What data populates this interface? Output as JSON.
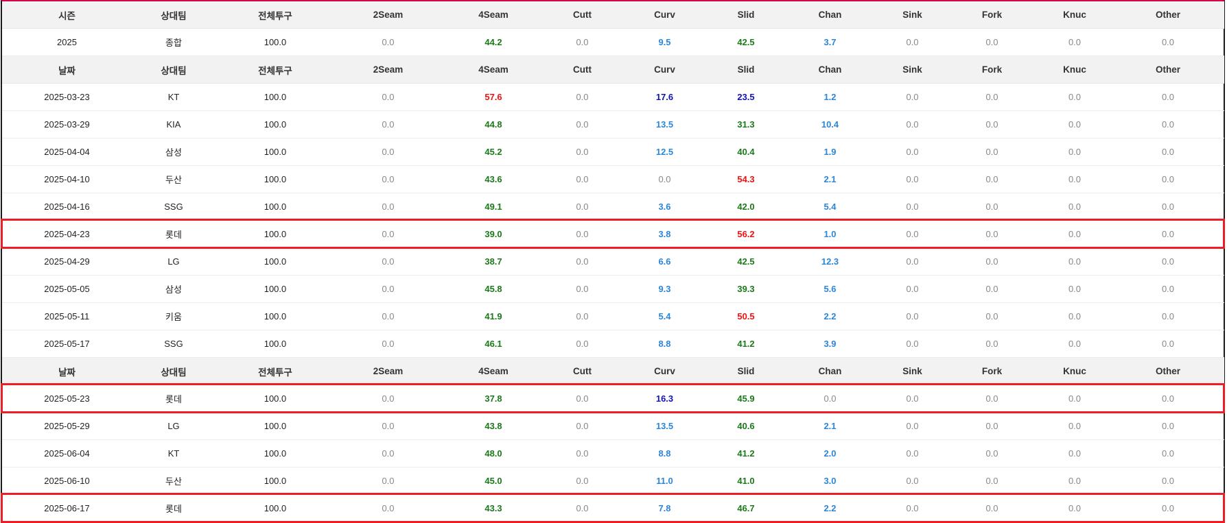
{
  "headers": {
    "season": [
      "시즌",
      "상대팀",
      "전체투구",
      "2Seam",
      "4Seam",
      "Cutt",
      "Curv",
      "Slid",
      "Chan",
      "Sink",
      "Fork",
      "Knuc",
      "Other"
    ],
    "daily": [
      "날짜",
      "상대팀",
      "전체투구",
      "2Seam",
      "4Seam",
      "Cutt",
      "Curv",
      "Slid",
      "Chan",
      "Sink",
      "Fork",
      "Knuc",
      "Other"
    ]
  },
  "colors": {
    "green": "#1a7a1a",
    "red": "#ee1111",
    "blue": "#2b86d9",
    "navy": "#0f13b5",
    "highlight_box": "#ee1c24"
  },
  "rows": [
    {
      "type": "header",
      "header": "season"
    },
    {
      "type": "data",
      "cells": [
        [
          "2025",
          "txt"
        ],
        [
          "종합",
          "txt"
        ],
        [
          "100.0",
          "txt"
        ],
        [
          "0.0",
          ""
        ],
        [
          "44.2",
          "green"
        ],
        [
          "0.0",
          ""
        ],
        [
          "9.5",
          "blue"
        ],
        [
          "42.5",
          "green"
        ],
        [
          "3.7",
          "blue"
        ],
        [
          "0.0",
          ""
        ],
        [
          "0.0",
          ""
        ],
        [
          "0.0",
          ""
        ],
        [
          "0.0",
          ""
        ]
      ]
    },
    {
      "type": "header",
      "header": "daily"
    },
    {
      "type": "data",
      "cells": [
        [
          "2025-03-23",
          "txt"
        ],
        [
          "KT",
          "txt"
        ],
        [
          "100.0",
          "txt"
        ],
        [
          "0.0",
          ""
        ],
        [
          "57.6",
          "red"
        ],
        [
          "0.0",
          ""
        ],
        [
          "17.6",
          "navy"
        ],
        [
          "23.5",
          "navy"
        ],
        [
          "1.2",
          "blue"
        ],
        [
          "0.0",
          ""
        ],
        [
          "0.0",
          ""
        ],
        [
          "0.0",
          ""
        ],
        [
          "0.0",
          ""
        ]
      ]
    },
    {
      "type": "data",
      "cells": [
        [
          "2025-03-29",
          "txt"
        ],
        [
          "KIA",
          "txt"
        ],
        [
          "100.0",
          "txt"
        ],
        [
          "0.0",
          ""
        ],
        [
          "44.8",
          "green"
        ],
        [
          "0.0",
          ""
        ],
        [
          "13.5",
          "blue"
        ],
        [
          "31.3",
          "green"
        ],
        [
          "10.4",
          "blue"
        ],
        [
          "0.0",
          ""
        ],
        [
          "0.0",
          ""
        ],
        [
          "0.0",
          ""
        ],
        [
          "0.0",
          ""
        ]
      ]
    },
    {
      "type": "data",
      "cells": [
        [
          "2025-04-04",
          "txt"
        ],
        [
          "삼성",
          "txt"
        ],
        [
          "100.0",
          "txt"
        ],
        [
          "0.0",
          ""
        ],
        [
          "45.2",
          "green"
        ],
        [
          "0.0",
          ""
        ],
        [
          "12.5",
          "blue"
        ],
        [
          "40.4",
          "green"
        ],
        [
          "1.9",
          "blue"
        ],
        [
          "0.0",
          ""
        ],
        [
          "0.0",
          ""
        ],
        [
          "0.0",
          ""
        ],
        [
          "0.0",
          ""
        ]
      ]
    },
    {
      "type": "data",
      "cells": [
        [
          "2025-04-10",
          "txt"
        ],
        [
          "두산",
          "txt"
        ],
        [
          "100.0",
          "txt"
        ],
        [
          "0.0",
          ""
        ],
        [
          "43.6",
          "green"
        ],
        [
          "0.0",
          ""
        ],
        [
          "0.0",
          ""
        ],
        [
          "54.3",
          "red"
        ],
        [
          "2.1",
          "blue"
        ],
        [
          "0.0",
          ""
        ],
        [
          "0.0",
          ""
        ],
        [
          "0.0",
          ""
        ],
        [
          "0.0",
          ""
        ]
      ]
    },
    {
      "type": "data",
      "cells": [
        [
          "2025-04-16",
          "txt"
        ],
        [
          "SSG",
          "txt"
        ],
        [
          "100.0",
          "txt"
        ],
        [
          "0.0",
          ""
        ],
        [
          "49.1",
          "green"
        ],
        [
          "0.0",
          ""
        ],
        [
          "3.6",
          "blue"
        ],
        [
          "42.0",
          "green"
        ],
        [
          "5.4",
          "blue"
        ],
        [
          "0.0",
          ""
        ],
        [
          "0.0",
          ""
        ],
        [
          "0.0",
          ""
        ],
        [
          "0.0",
          ""
        ]
      ]
    },
    {
      "type": "data",
      "highlight": true,
      "cells": [
        [
          "2025-04-23",
          "txt"
        ],
        [
          "롯데",
          "txt"
        ],
        [
          "100.0",
          "txt"
        ],
        [
          "0.0",
          ""
        ],
        [
          "39.0",
          "green"
        ],
        [
          "0.0",
          ""
        ],
        [
          "3.8",
          "blue"
        ],
        [
          "56.2",
          "red"
        ],
        [
          "1.0",
          "blue"
        ],
        [
          "0.0",
          ""
        ],
        [
          "0.0",
          ""
        ],
        [
          "0.0",
          ""
        ],
        [
          "0.0",
          ""
        ]
      ]
    },
    {
      "type": "data",
      "cells": [
        [
          "2025-04-29",
          "txt"
        ],
        [
          "LG",
          "txt"
        ],
        [
          "100.0",
          "txt"
        ],
        [
          "0.0",
          ""
        ],
        [
          "38.7",
          "green"
        ],
        [
          "0.0",
          ""
        ],
        [
          "6.6",
          "blue"
        ],
        [
          "42.5",
          "green"
        ],
        [
          "12.3",
          "blue"
        ],
        [
          "0.0",
          ""
        ],
        [
          "0.0",
          ""
        ],
        [
          "0.0",
          ""
        ],
        [
          "0.0",
          ""
        ]
      ]
    },
    {
      "type": "data",
      "cells": [
        [
          "2025-05-05",
          "txt"
        ],
        [
          "삼성",
          "txt"
        ],
        [
          "100.0",
          "txt"
        ],
        [
          "0.0",
          ""
        ],
        [
          "45.8",
          "green"
        ],
        [
          "0.0",
          ""
        ],
        [
          "9.3",
          "blue"
        ],
        [
          "39.3",
          "green"
        ],
        [
          "5.6",
          "blue"
        ],
        [
          "0.0",
          ""
        ],
        [
          "0.0",
          ""
        ],
        [
          "0.0",
          ""
        ],
        [
          "0.0",
          ""
        ]
      ]
    },
    {
      "type": "data",
      "cells": [
        [
          "2025-05-11",
          "txt"
        ],
        [
          "키움",
          "txt"
        ],
        [
          "100.0",
          "txt"
        ],
        [
          "0.0",
          ""
        ],
        [
          "41.9",
          "green"
        ],
        [
          "0.0",
          ""
        ],
        [
          "5.4",
          "blue"
        ],
        [
          "50.5",
          "red"
        ],
        [
          "2.2",
          "blue"
        ],
        [
          "0.0",
          ""
        ],
        [
          "0.0",
          ""
        ],
        [
          "0.0",
          ""
        ],
        [
          "0.0",
          ""
        ]
      ]
    },
    {
      "type": "data",
      "cells": [
        [
          "2025-05-17",
          "txt"
        ],
        [
          "SSG",
          "txt"
        ],
        [
          "100.0",
          "txt"
        ],
        [
          "0.0",
          ""
        ],
        [
          "46.1",
          "green"
        ],
        [
          "0.0",
          ""
        ],
        [
          "8.8",
          "blue"
        ],
        [
          "41.2",
          "green"
        ],
        [
          "3.9",
          "blue"
        ],
        [
          "0.0",
          ""
        ],
        [
          "0.0",
          ""
        ],
        [
          "0.0",
          ""
        ],
        [
          "0.0",
          ""
        ]
      ]
    },
    {
      "type": "header",
      "header": "daily"
    },
    {
      "type": "data",
      "highlight": true,
      "cells": [
        [
          "2025-05-23",
          "txt"
        ],
        [
          "롯데",
          "txt"
        ],
        [
          "100.0",
          "txt"
        ],
        [
          "0.0",
          ""
        ],
        [
          "37.8",
          "green"
        ],
        [
          "0.0",
          ""
        ],
        [
          "16.3",
          "navy"
        ],
        [
          "45.9",
          "green"
        ],
        [
          "0.0",
          ""
        ],
        [
          "0.0",
          ""
        ],
        [
          "0.0",
          ""
        ],
        [
          "0.0",
          ""
        ],
        [
          "0.0",
          ""
        ]
      ]
    },
    {
      "type": "data",
      "cells": [
        [
          "2025-05-29",
          "txt"
        ],
        [
          "LG",
          "txt"
        ],
        [
          "100.0",
          "txt"
        ],
        [
          "0.0",
          ""
        ],
        [
          "43.8",
          "green"
        ],
        [
          "0.0",
          ""
        ],
        [
          "13.5",
          "blue"
        ],
        [
          "40.6",
          "green"
        ],
        [
          "2.1",
          "blue"
        ],
        [
          "0.0",
          ""
        ],
        [
          "0.0",
          ""
        ],
        [
          "0.0",
          ""
        ],
        [
          "0.0",
          ""
        ]
      ]
    },
    {
      "type": "data",
      "cells": [
        [
          "2025-06-04",
          "txt"
        ],
        [
          "KT",
          "txt"
        ],
        [
          "100.0",
          "txt"
        ],
        [
          "0.0",
          ""
        ],
        [
          "48.0",
          "green"
        ],
        [
          "0.0",
          ""
        ],
        [
          "8.8",
          "blue"
        ],
        [
          "41.2",
          "green"
        ],
        [
          "2.0",
          "blue"
        ],
        [
          "0.0",
          ""
        ],
        [
          "0.0",
          ""
        ],
        [
          "0.0",
          ""
        ],
        [
          "0.0",
          ""
        ]
      ]
    },
    {
      "type": "data",
      "cells": [
        [
          "2025-06-10",
          "txt"
        ],
        [
          "두산",
          "txt"
        ],
        [
          "100.0",
          "txt"
        ],
        [
          "0.0",
          ""
        ],
        [
          "45.0",
          "green"
        ],
        [
          "0.0",
          ""
        ],
        [
          "11.0",
          "blue"
        ],
        [
          "41.0",
          "green"
        ],
        [
          "3.0",
          "blue"
        ],
        [
          "0.0",
          ""
        ],
        [
          "0.0",
          ""
        ],
        [
          "0.0",
          ""
        ],
        [
          "0.0",
          ""
        ]
      ]
    },
    {
      "type": "data",
      "highlight": true,
      "cells": [
        [
          "2025-06-17",
          "txt"
        ],
        [
          "롯데",
          "txt"
        ],
        [
          "100.0",
          "txt"
        ],
        [
          "0.0",
          ""
        ],
        [
          "43.3",
          "green"
        ],
        [
          "0.0",
          ""
        ],
        [
          "7.8",
          "blue"
        ],
        [
          "46.7",
          "green"
        ],
        [
          "2.2",
          "blue"
        ],
        [
          "0.0",
          ""
        ],
        [
          "0.0",
          ""
        ],
        [
          "0.0",
          ""
        ],
        [
          "0.0",
          ""
        ]
      ]
    }
  ]
}
